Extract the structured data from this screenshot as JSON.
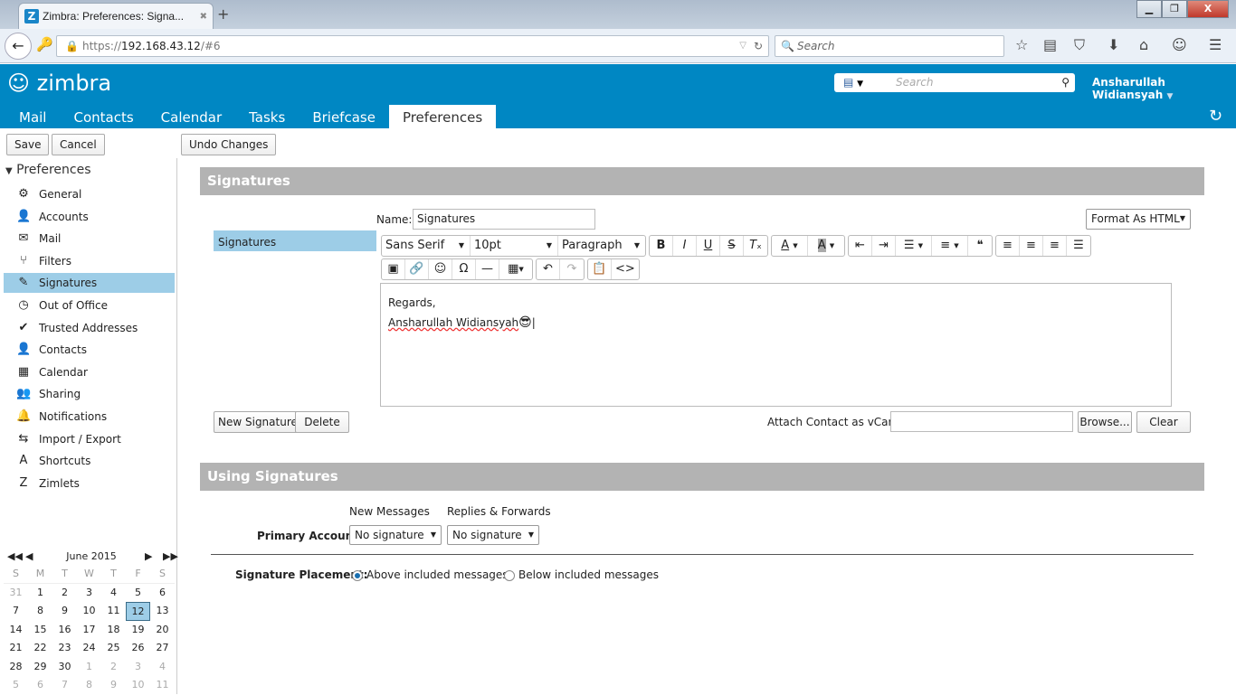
{
  "browser": {
    "tab_title": "Zimbra: Preferences: Signa...",
    "url_prefix": "https://",
    "url_host": "192.168.43.12",
    "url_path": "/#6",
    "search_placeholder": "Search"
  },
  "header": {
    "logo": "zimbra",
    "search_placeholder": "Search",
    "user": "Ansharullah Widiansyah"
  },
  "app_tabs": [
    "Mail",
    "Contacts",
    "Calendar",
    "Tasks",
    "Briefcase",
    "Preferences"
  ],
  "toolbar": {
    "save": "Save",
    "cancel": "Cancel",
    "undo": "Undo Changes"
  },
  "sidebar": {
    "title": "Preferences",
    "items": [
      {
        "label": "General",
        "icon": "gear-icon",
        "glyph": "⚙"
      },
      {
        "label": "Accounts",
        "icon": "accounts-icon",
        "glyph": "👤"
      },
      {
        "label": "Mail",
        "icon": "mail-icon",
        "glyph": "✉"
      },
      {
        "label": "Filters",
        "icon": "filter-icon",
        "glyph": "⑂"
      },
      {
        "label": "Signatures",
        "icon": "signature-icon",
        "glyph": "✎",
        "selected": true
      },
      {
        "label": "Out of Office",
        "icon": "out-of-office-icon",
        "glyph": "◷"
      },
      {
        "label": "Trusted Addresses",
        "icon": "shield-icon",
        "glyph": "✔"
      },
      {
        "label": "Contacts",
        "icon": "contacts-icon",
        "glyph": "👤"
      },
      {
        "label": "Calendar",
        "icon": "calendar-icon",
        "glyph": "▦"
      },
      {
        "label": "Sharing",
        "icon": "sharing-icon",
        "glyph": "👥"
      },
      {
        "label": "Notifications",
        "icon": "bell-icon",
        "glyph": "🔔"
      },
      {
        "label": "Import / Export",
        "icon": "import-export-icon",
        "glyph": "⇆"
      },
      {
        "label": "Shortcuts",
        "icon": "shortcuts-icon",
        "glyph": "A"
      },
      {
        "label": "Zimlets",
        "icon": "zimlets-icon",
        "glyph": "Z"
      }
    ]
  },
  "calendar": {
    "month": "June 2015",
    "dow": [
      "S",
      "M",
      "T",
      "W",
      "T",
      "F",
      "S"
    ],
    "days": [
      31,
      1,
      2,
      3,
      4,
      5,
      6,
      7,
      8,
      9,
      10,
      11,
      12,
      13,
      14,
      15,
      16,
      17,
      18,
      19,
      20,
      21,
      22,
      23,
      24,
      25,
      26,
      27,
      28,
      29,
      30,
      1,
      2,
      3,
      4,
      5,
      6,
      7,
      8,
      9,
      10,
      11
    ],
    "today": 12
  },
  "signatures": {
    "section_title": "Signatures",
    "list": [
      "Signatures"
    ],
    "name_label": "Name:",
    "name_value": "Signatures",
    "format": "Format As HTML",
    "font": "Sans Serif",
    "size": "10pt",
    "block": "Paragraph",
    "body_line1": "Regards,",
    "body_line2": "Ansharullah Widiansyah",
    "new_signature": "New Signature",
    "delete": "Delete",
    "vcard_label": "Attach Contact as vCard:",
    "vcard_value": "",
    "browse": "Browse...",
    "clear": "Clear"
  },
  "using": {
    "section_title": "Using Signatures",
    "col_new": "New Messages",
    "col_replies": "Replies & Forwards",
    "primary_label": "Primary Account:",
    "new_value": "No signature",
    "replies_value": "No signature",
    "placement_label": "Signature Placement:",
    "above": "Above included messages",
    "below": "Below included messages",
    "selected": "above"
  }
}
